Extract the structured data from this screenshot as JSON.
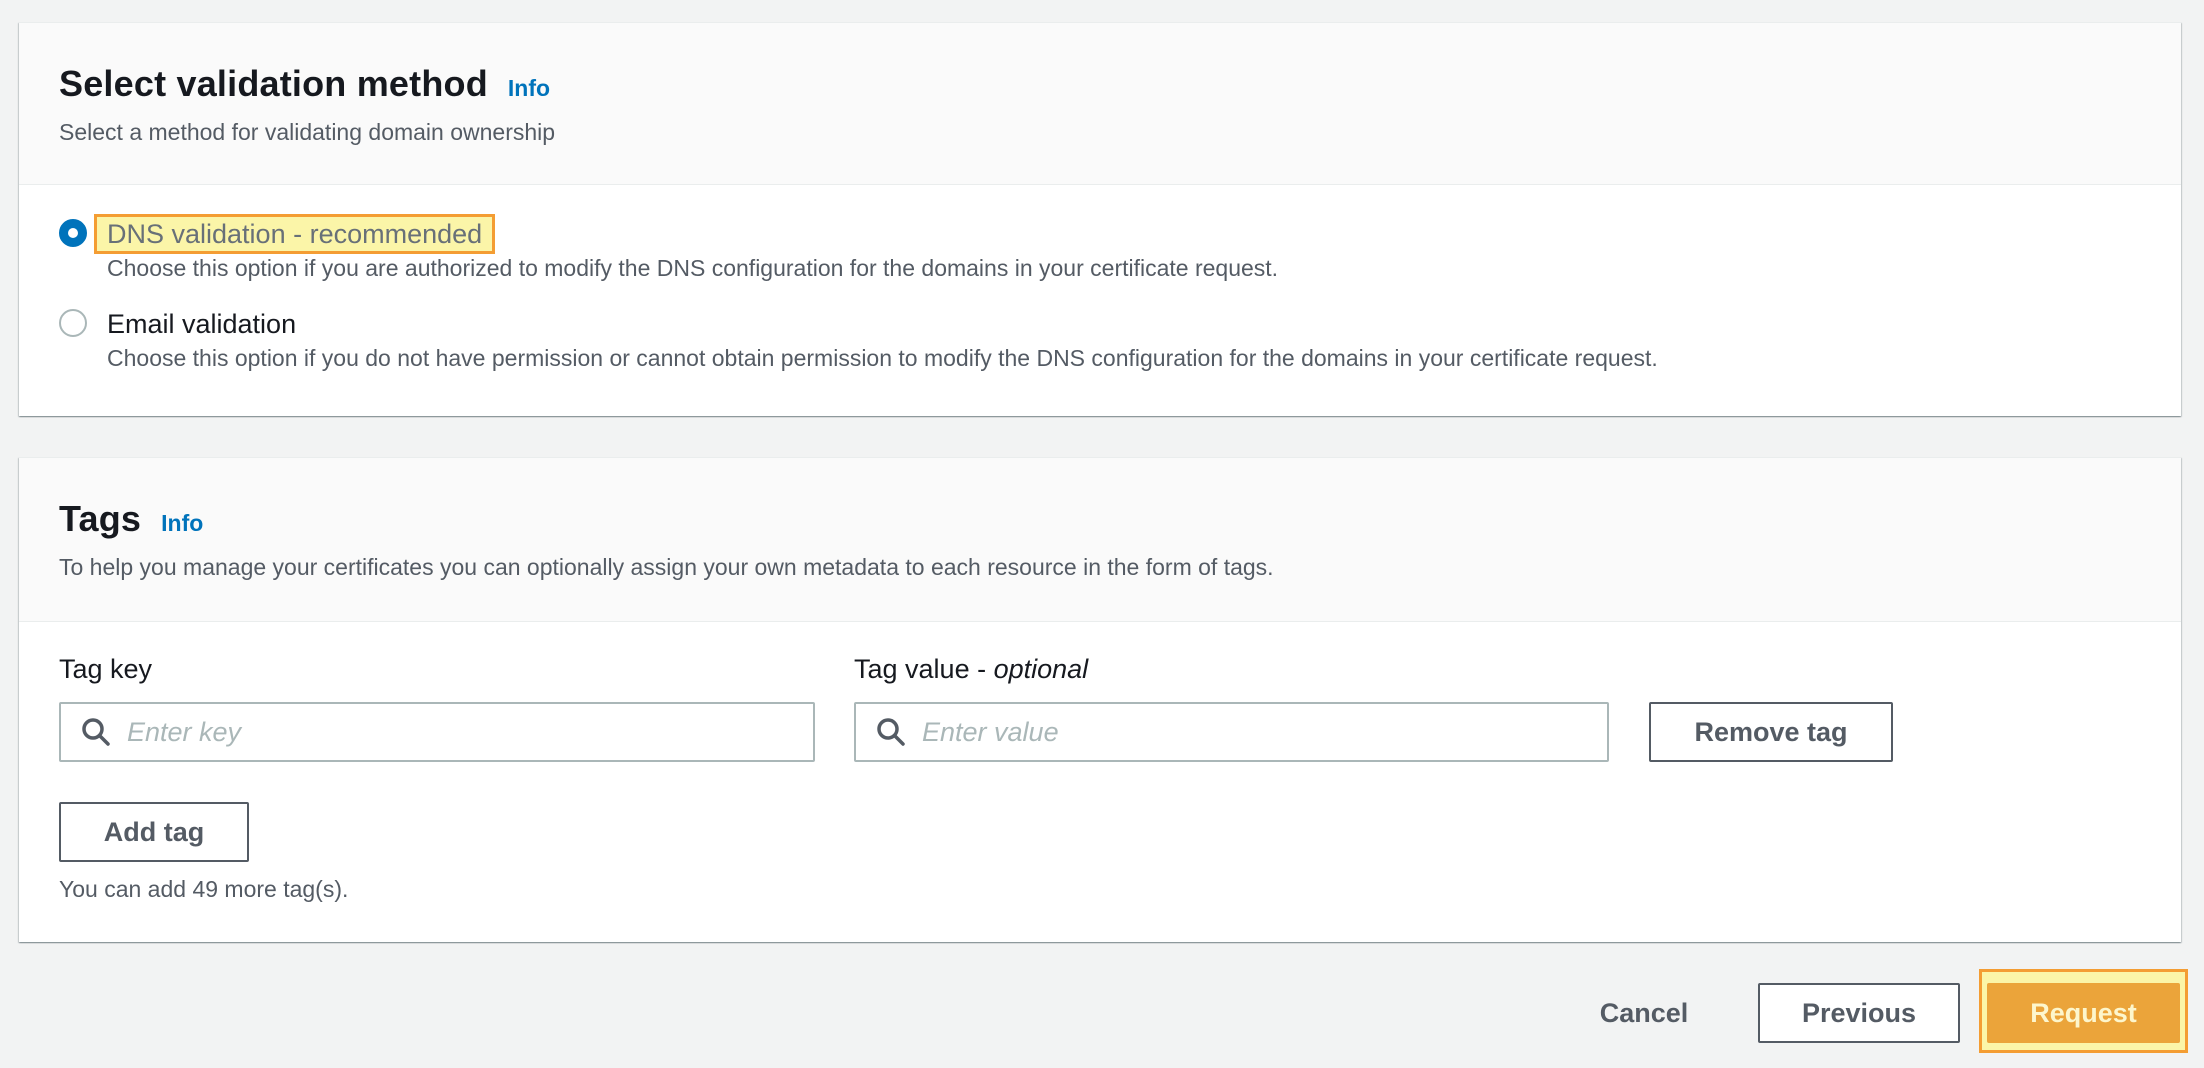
{
  "validation": {
    "title": "Select validation method",
    "info_link": "Info",
    "description": "Select a method for validating domain ownership",
    "options": [
      {
        "label": "DNS validation - recommended",
        "help": "Choose this option if you are authorized to modify the DNS configuration for the domains in your certificate request.",
        "selected": true
      },
      {
        "label": "Email validation",
        "help": "Choose this option if you do not have permission or cannot obtain permission to modify the DNS configuration for the domains in your certificate request.",
        "selected": false
      }
    ]
  },
  "tags": {
    "title": "Tags",
    "info_link": "Info",
    "description": "To help you manage your certificates you can optionally assign your own metadata to each resource in the form of tags.",
    "key_label": "Tag key",
    "value_label_main": "Tag value - ",
    "value_label_optional": "optional",
    "key_placeholder": "Enter key",
    "value_placeholder": "Enter value",
    "remove_button": "Remove tag",
    "add_button": "Add tag",
    "remaining_hint": "You can add 49 more tag(s)."
  },
  "footer": {
    "cancel": "Cancel",
    "previous": "Previous",
    "request": "Request"
  },
  "colors": {
    "link": "#0073bb",
    "primary_button": "#eba43a",
    "highlight_fill": "#fbf5a8",
    "highlight_border": "#f49d33"
  },
  "icons": {
    "key_search": "search-icon",
    "value_search": "search-icon"
  }
}
